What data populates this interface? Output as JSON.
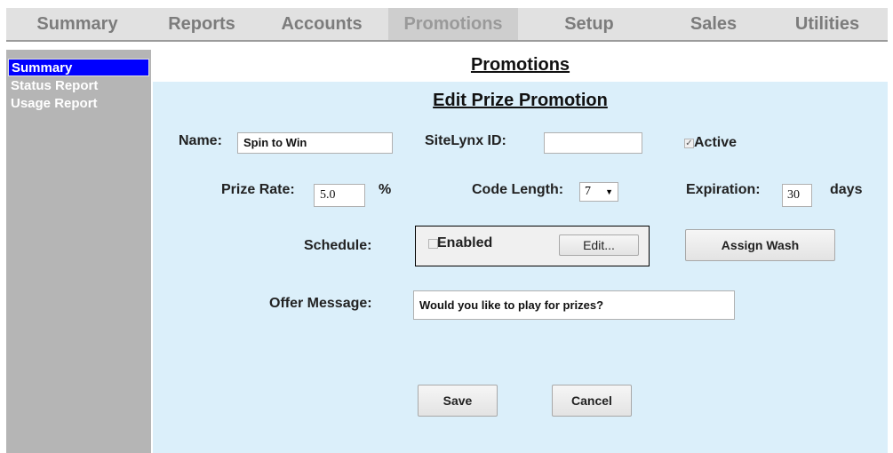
{
  "nav": {
    "tabs": [
      {
        "label": "Summary",
        "active": false
      },
      {
        "label": "Reports",
        "active": false
      },
      {
        "label": "Accounts",
        "active": false
      },
      {
        "label": "Promotions",
        "active": true
      },
      {
        "label": "Setup",
        "active": false
      },
      {
        "label": "Sales",
        "active": false
      },
      {
        "label": "Utilities",
        "active": false
      }
    ]
  },
  "sidebar": {
    "items": [
      {
        "label": "Summary",
        "active": true
      },
      {
        "label": "Status Report",
        "active": false
      },
      {
        "label": "Usage Report",
        "active": false
      }
    ]
  },
  "page": {
    "title": "Promotions"
  },
  "form": {
    "title": "Edit Prize Promotion",
    "name": {
      "label": "Name:",
      "value": "Spin to Win"
    },
    "sitelynx": {
      "label": "SiteLynx ID:",
      "value": ""
    },
    "active": {
      "label": "Active",
      "checked": true
    },
    "prize_rate": {
      "label": "Prize Rate:",
      "value": "5.0",
      "unit": "%"
    },
    "code_length": {
      "label": "Code Length:",
      "value": "7"
    },
    "expiration": {
      "label": "Expiration:",
      "value": "30",
      "unit": "days"
    },
    "schedule": {
      "label": "Schedule:",
      "enabled_label": "Enabled",
      "enabled": false,
      "edit_label": "Edit..."
    },
    "assign_wash_label": "Assign Wash",
    "offer_message": {
      "label": "Offer Message:",
      "value": "Would you like to play for prizes?"
    },
    "save_label": "Save",
    "cancel_label": "Cancel"
  },
  "icons": {
    "checkbox_checked": "check-icon",
    "dropdown": "chevron-down-icon"
  },
  "colors": {
    "sidebar_active": "#0000ff",
    "main_bg": "#dbeffa",
    "sidebar_bg": "#b5b5b5",
    "nav_bg": "#e1e1e1"
  }
}
